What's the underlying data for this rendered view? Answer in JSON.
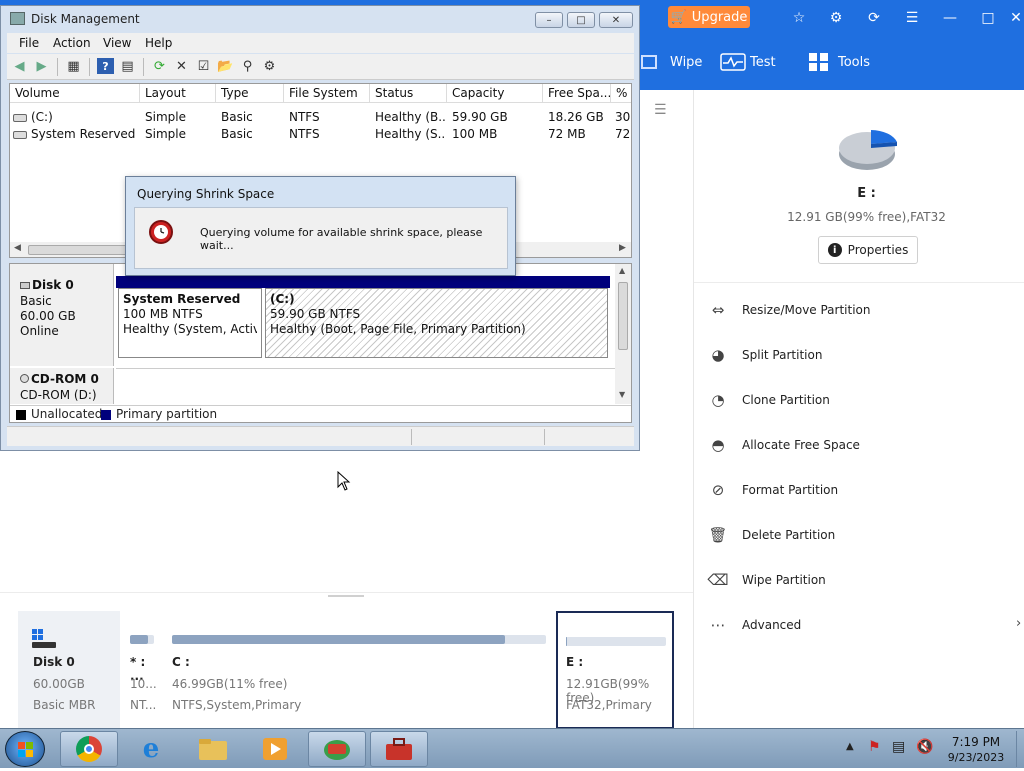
{
  "app": {
    "upgrade_label": "Upgrade",
    "tabs": [
      {
        "label": "Wipe",
        "icon": "wipe-icon"
      },
      {
        "label": "Test",
        "icon": "pulse-icon"
      },
      {
        "label": "Tools",
        "icon": "grid-icon"
      }
    ],
    "selected_partition": {
      "name": "E :",
      "info": "12.91 GB(99% free),FAT32",
      "properties_label": "Properties"
    },
    "operations": [
      {
        "label": "Resize/Move Partition",
        "icon": "resize-icon"
      },
      {
        "label": "Split Partition",
        "icon": "split-icon"
      },
      {
        "label": "Clone Partition",
        "icon": "clone-icon"
      },
      {
        "label": "Allocate Free Space",
        "icon": "allocate-icon"
      },
      {
        "label": "Format Partition",
        "icon": "format-icon"
      },
      {
        "label": "Delete Partition",
        "icon": "trash-icon"
      },
      {
        "label": "Wipe Partition",
        "icon": "eraser-icon"
      },
      {
        "label": "Advanced",
        "icon": "more-icon"
      }
    ],
    "disk": {
      "name": "Disk 0",
      "size": "60.00GB",
      "type": "Basic MBR"
    },
    "partitions": [
      {
        "name": "* : ...",
        "size": "10...",
        "fs": "NT...",
        "used_fraction": 0.75
      },
      {
        "name": "C :",
        "size": "46.99GB(11% free)",
        "fs": "NTFS,System,Primary",
        "used_fraction": 0.89
      },
      {
        "name": "E :",
        "size": "12.91GB(99% free)",
        "fs": "FAT32,Primary",
        "used_fraction": 0.01
      }
    ]
  },
  "disk_management": {
    "title": "Disk Management",
    "menu": [
      "File",
      "Action",
      "View",
      "Help"
    ],
    "columns": [
      "Volume",
      "Layout",
      "Type",
      "File System",
      "Status",
      "Capacity",
      "Free Spa...",
      "% F"
    ],
    "rows": [
      [
        "(C:)",
        "Simple",
        "Basic",
        "NTFS",
        "Healthy (B...",
        "59.90 GB",
        "18.26 GB",
        "30"
      ],
      [
        "System Reserved",
        "Simple",
        "Basic",
        "NTFS",
        "Healthy (S...",
        "100 MB",
        "72 MB",
        "72"
      ]
    ],
    "disks": [
      {
        "name": "Disk 0",
        "type": "Basic",
        "size": "60.00 GB",
        "state": "Online"
      },
      {
        "name": "CD-ROM 0",
        "type": "CD-ROM (D:)"
      }
    ],
    "graph_partitions": [
      {
        "name": "System Reserved",
        "line1": "100 MB NTFS",
        "line2": "Healthy (System, Active,"
      },
      {
        "name": "(C:)",
        "line1": "59.90 GB NTFS",
        "line2": "Healthy (Boot, Page File, Primary Partition)"
      }
    ],
    "legend": [
      {
        "label": "Unallocated",
        "color": "#000000"
      },
      {
        "label": "Primary partition",
        "color": "#00007c"
      }
    ]
  },
  "dialog": {
    "title": "Querying Shrink Space",
    "message": "Querying volume for available shrink space, please wait..."
  },
  "taskbar": {
    "time": "7:19 PM",
    "date": "9/23/2023"
  },
  "colors": {
    "app_header": "#1f6fe0",
    "upgrade": "#ff8a3a"
  }
}
